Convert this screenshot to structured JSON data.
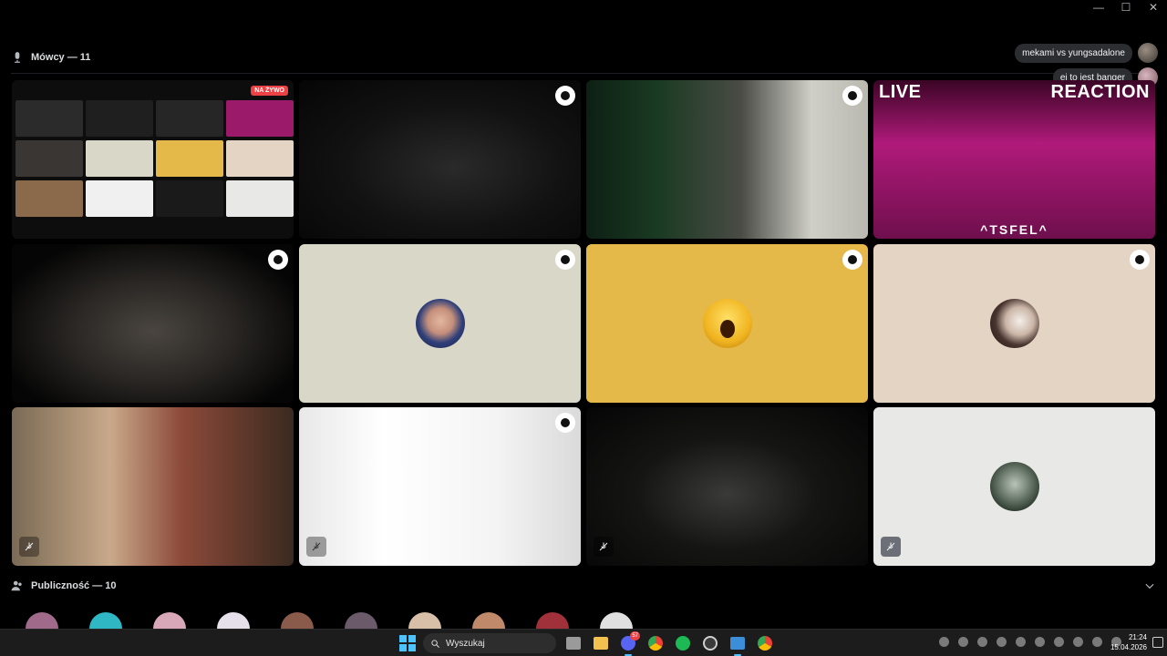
{
  "window": {
    "controls": [
      "—",
      "☐",
      "✕"
    ]
  },
  "speakers": {
    "label": "Mówcy — 11"
  },
  "audience": {
    "label": "Publiczność — 10"
  },
  "chat": [
    {
      "text": "mekami vs yungsadalone"
    },
    {
      "text": "ej to jest banger"
    }
  ],
  "tiles": {
    "screen_share": {
      "live_label": "NA ŻYWO"
    },
    "stream": {
      "live_word": "LIVE",
      "reaction_word": "REACTION",
      "handle": "^TSFEL^"
    }
  },
  "taskbar": {
    "search_placeholder": "Wyszukaj",
    "discord_badge": "57",
    "time": "21:24",
    "date": "15.04.2026"
  },
  "colors": {
    "background": "#000000",
    "tile_cream": "#d9d8c8",
    "tile_yellow": "#e5b84a",
    "tile_beige": "#e3d4c4",
    "tile_lightgray": "#e8e8e6",
    "live_red": "#ed4245",
    "accent": "#4cc2ff"
  }
}
